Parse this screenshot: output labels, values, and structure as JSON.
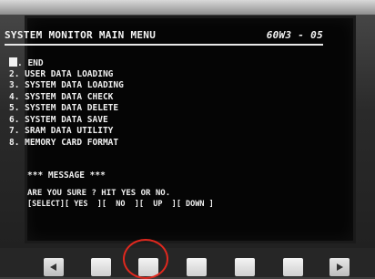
{
  "screen": {
    "title": "SYSTEM MONITOR MAIN MENU",
    "code": "60W3 - 05",
    "menu_items": [
      ". END",
      "2. USER DATA LOADING",
      "3. SYSTEM DATA LOADING",
      "4. SYSTEM DATA CHECK",
      "5. SYSTEM DATA DELETE",
      "6. SYSTEM DATA SAVE",
      "7. SRAM DATA UTILITY",
      "8. MEMORY CARD FORMAT"
    ],
    "message_title": "*** MESSAGE ***",
    "message_prompt": "ARE YOU SURE ? HIT YES OR NO.",
    "softkeys": {
      "select": "[SELECT]",
      "yes": "[ YES  ]",
      "no": "[  NO  ]",
      "up": "[  UP  ]",
      "down": "[ DOWN ]"
    }
  },
  "hardware": {
    "highlight_color": "#e0281e"
  }
}
